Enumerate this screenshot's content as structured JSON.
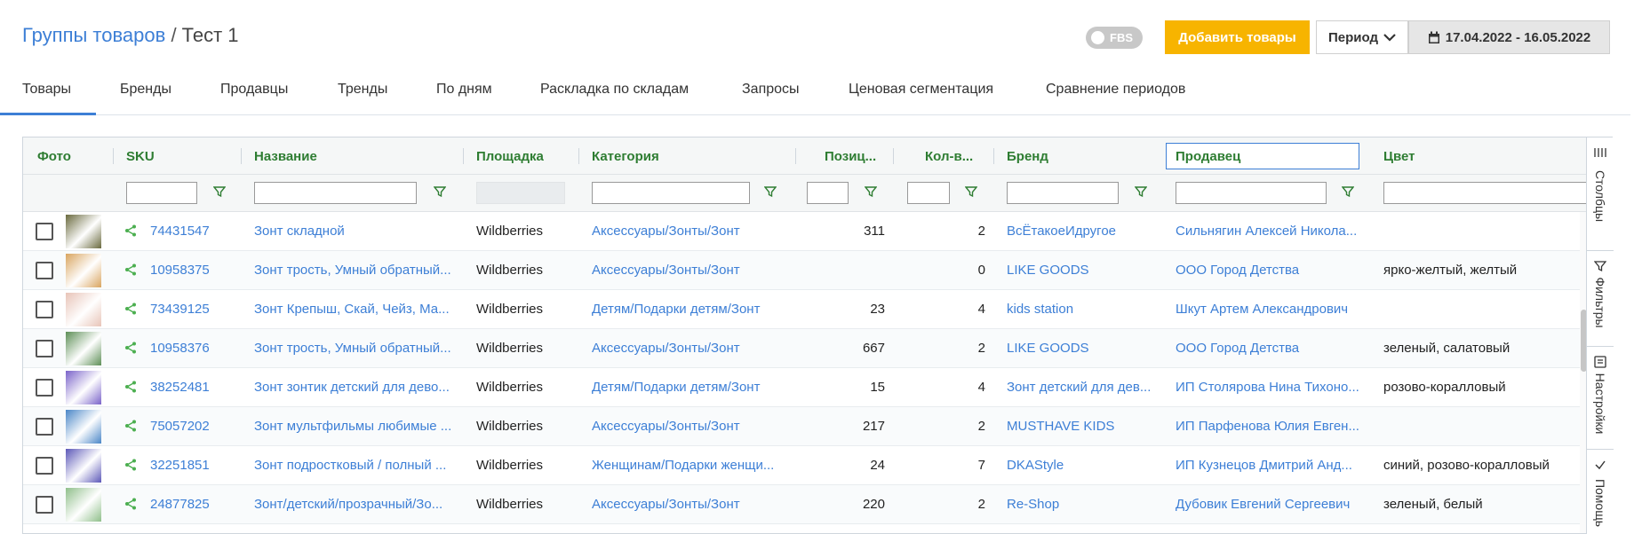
{
  "header": {
    "breadcrumb_link": "Группы товаров",
    "breadcrumb_sep": " / ",
    "breadcrumb_current": "Тест 1",
    "fbs_label": "FBS",
    "add_button": "Добавить товары",
    "period_button": "Период",
    "date_range": "17.04.2022 - 16.05.2022"
  },
  "tabs": [
    {
      "label": "Товары",
      "active": true
    },
    {
      "label": "Бренды"
    },
    {
      "label": "Продавцы"
    },
    {
      "label": "Тренды"
    },
    {
      "label": "По дням"
    },
    {
      "label": "Раскладка по складам"
    },
    {
      "label": "Запросы"
    },
    {
      "label": "Ценовая сегментация"
    },
    {
      "label": "Сравнение периодов"
    }
  ],
  "columns": {
    "photo": "Фото",
    "sku": "SKU",
    "name": "Название",
    "platform": "Площадка",
    "category": "Категория",
    "position": "Позиц...",
    "qty": "Кол-в...",
    "brand": "Бренд",
    "seller": "Продавец",
    "color": "Цвет"
  },
  "rows": [
    {
      "sku": "74431547",
      "name": "Зонт складной",
      "platform": "Wildberries",
      "category": "Аксессуары/Зонты/Зонт",
      "position": "311",
      "qty": "2",
      "brand": "ВсЁтакоеИдругое",
      "seller": "Сильнягин Алексей Никола...",
      "color": "",
      "thumb": "#6a6a3e"
    },
    {
      "sku": "10958375",
      "name": "Зонт трость, Умный обратный...",
      "platform": "Wildberries",
      "category": "Аксессуары/Зонты/Зонт",
      "position": "",
      "qty": "0",
      "brand": "LIKE GOODS",
      "seller": "ООО Город Детства",
      "color": "ярко-желтый, желтый",
      "thumb": "#d9a560"
    },
    {
      "sku": "73439125",
      "name": "Зонт Крепыш, Скай, Чейз, Ма...",
      "platform": "Wildberries",
      "category": "Детям/Подарки детям/Зонт",
      "position": "23",
      "qty": "4",
      "brand": "kids station",
      "seller": "Шкут Артем Александрович",
      "color": "",
      "thumb": "#e8c4b8"
    },
    {
      "sku": "10958376",
      "name": "Зонт трость, Умный обратный...",
      "platform": "Wildberries",
      "category": "Аксессуары/Зонты/Зонт",
      "position": "667",
      "qty": "2",
      "brand": "LIKE GOODS",
      "seller": "ООО Город Детства",
      "color": "зеленый, салатовый",
      "thumb": "#5e8f57"
    },
    {
      "sku": "38252481",
      "name": "Зонт зонтик детский для дево...",
      "platform": "Wildberries",
      "category": "Детям/Подарки детям/Зонт",
      "position": "15",
      "qty": "4",
      "brand": "Зонт детский для дев...",
      "seller": "ИП Столярова Нина Тихоно...",
      "color": "розово-коралловый",
      "thumb": "#7a63c9"
    },
    {
      "sku": "75057202",
      "name": "Зонт мультфильмы любимые ...",
      "platform": "Wildberries",
      "category": "Аксессуары/Зонты/Зонт",
      "position": "217",
      "qty": "2",
      "brand": "MUSTHAVE KIDS",
      "seller": "ИП Парфенова Юлия Евген...",
      "color": "",
      "thumb": "#4a86c7"
    },
    {
      "sku": "32251851",
      "name": "Зонт подростковый / полный ...",
      "platform": "Wildberries",
      "category": "Женщинам/Подарки женщи...",
      "position": "24",
      "qty": "7",
      "brand": "DKAStyle",
      "seller": "ИП Кузнецов Дмитрий Анд...",
      "color": "синий, розово-коралловый",
      "thumb": "#5c58b8"
    },
    {
      "sku": "24877825",
      "name": "Зонт/детский/прозрачный/Зо...",
      "platform": "Wildberries",
      "category": "Аксессуары/Зонты/Зонт",
      "position": "220",
      "qty": "2",
      "brand": "Re-Shop",
      "seller": "Дубовик Евгений Сергеевич",
      "color": "зеленый, белый",
      "thumb": "#8fbf8a"
    }
  ],
  "side_panel": {
    "columns": "Столбцы",
    "filters": "Фильтры",
    "settings": "Настройки",
    "help": "Помощь"
  },
  "colors": {
    "accent": "#3d7fd6",
    "header_green": "#2e7d32",
    "add_button": "#f7b400"
  }
}
